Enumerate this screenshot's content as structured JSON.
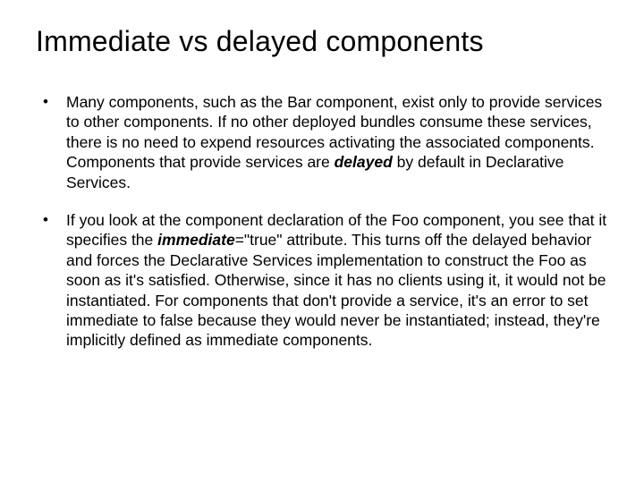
{
  "title": "Immediate vs delayed components",
  "bullets": [
    {
      "pre": "Many components, such as the Bar component, exist only to provide services to other components. If no other deployed bundles consume these services, there is no need to expend resources activating the associated components. Components that provide services are ",
      "em": "delayed",
      "post": " by default in Declarative Services."
    },
    {
      "pre": "If you look at the component declaration of the Foo component, you see that it specifies the ",
      "em": "immediate",
      "post": "=\"true\" attribute. This turns off the delayed behavior and forces the Declarative Services implementation to construct the Foo as soon as it's satisfied. Otherwise, since it has no clients using it, it would not be instantiated. For components that don't provide a service, it's an error to set immediate to false because they would never be instantiated; instead, they're implicitly defined as immediate components."
    }
  ]
}
